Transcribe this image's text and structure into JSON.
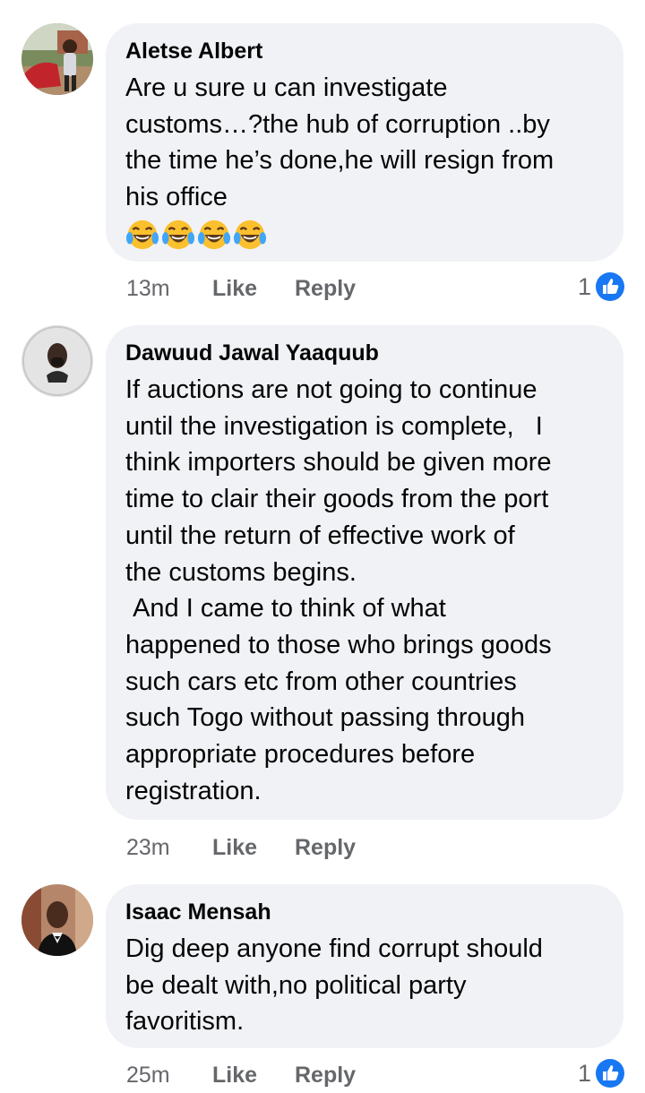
{
  "comments": [
    {
      "author": "Aletse Albert",
      "text": "Are u sure u can investigate\ncustoms…?the hub of corruption ..by\nthe time he’s done,he will resign from\nhis office",
      "emoji": [
        "laughing-tears",
        "laughing-tears",
        "laughing-tears",
        "laughing-tears"
      ],
      "time": "13m",
      "like_label": "Like",
      "reply_label": "Reply",
      "reaction_count": "1",
      "reaction_icon": "thumbs-up-icon"
    },
    {
      "author": "Dawuud Jawal Yaaquub",
      "text": "If auctions are not going to continue\nuntil the investigation is complete,   I\nthink importers should be given more\ntime to clair their goods from the port\nuntil the return of effective work of\nthe customs begins.\n And I came to think of what\nhappened to those who brings goods\nsuch cars etc from other countries\nsuch Togo without passing through\nappropriate procedures before\nregistration.",
      "time": "23m",
      "like_label": "Like",
      "reply_label": "Reply"
    },
    {
      "author": "Isaac Mensah",
      "text": "Dig deep anyone find corrupt should\nbe dealt with,no political party\nfavoritism.",
      "time": "25m",
      "like_label": "Like",
      "reply_label": "Reply",
      "reaction_count": "1",
      "reaction_icon": "thumbs-up-icon"
    }
  ],
  "colors": {
    "bubble": "#f0f2f5",
    "meta_text": "#65676b",
    "like_blue": "#1877f2"
  }
}
